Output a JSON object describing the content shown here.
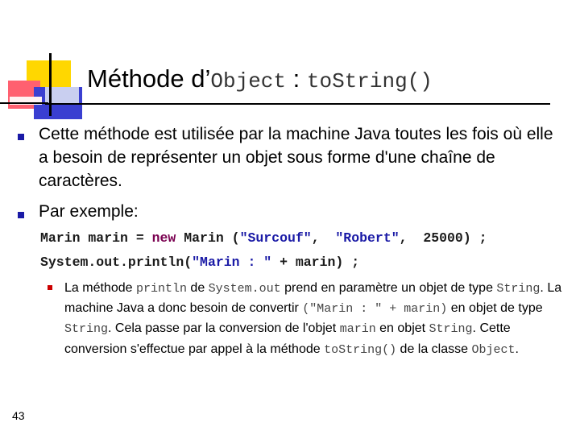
{
  "slide": {
    "title_prefix": "Méthode d’",
    "title_class": "Object",
    "title_sep": " : ",
    "title_method": "toString()",
    "bullet_1": "Cette méthode est utilisée par la machine Java toutes les fois où elle a besoin de représenter un objet sous forme d'une chaîne de caractères.",
    "bullet_2": "Par exemple:",
    "code": {
      "line1_a": "Marin marin = ",
      "line1_kw": "new",
      "line1_b": " Marin (",
      "line1_s1": "\"Surcouf\"",
      "line1_c": ",  ",
      "line1_s2": "\"Robert\"",
      "line1_d": ",  25000) ;",
      "line2_a": "System.out.println(",
      "line2_s": "\"Marin : \"",
      "line2_b": " + marin) ;"
    },
    "sub": {
      "t1": "La méthode ",
      "c1": "println",
      "t2": " de ",
      "c2": "System.out",
      "t3": "  prend en paramètre un objet de type ",
      "c3": "String",
      "t4": ". La machine Java a donc besoin de convertir ",
      "c4": "(\"Marin : \" + marin)",
      "t5": "  en objet de type ",
      "c5": "String",
      "t6": ". Cela passe par la conversion de l'objet ",
      "c6": "marin",
      "t7": "  en objet ",
      "c7": "String",
      "t8": ". Cette conversion s'effectue par appel à la méthode ",
      "c8": "toString()",
      "t9": " de la classe ",
      "c9": "Object",
      "t10": "."
    },
    "page_number": "43"
  },
  "colors": {
    "bullet_blue": "#1a1aa6",
    "bullet_red": "#cc0000",
    "deco_yellow": "#ffd700",
    "deco_red": "#ff6070",
    "deco_blue": "#3a3fd1"
  }
}
